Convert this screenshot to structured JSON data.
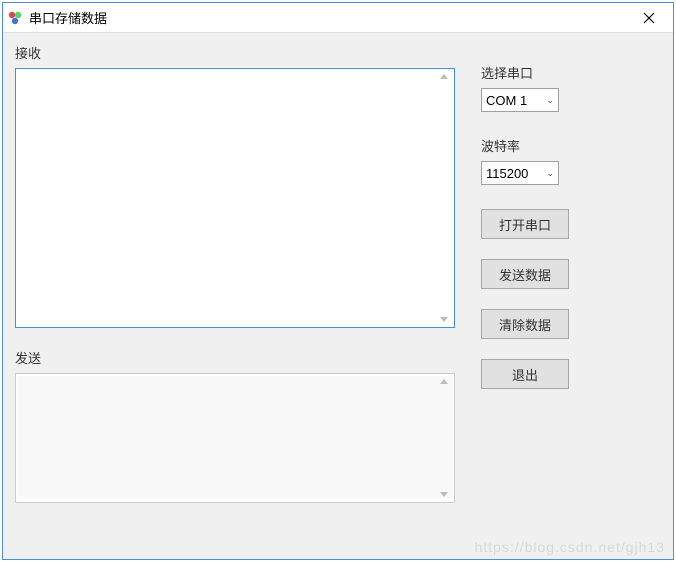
{
  "window": {
    "title": "串口存储数据"
  },
  "recv": {
    "label": "接收",
    "value": ""
  },
  "send": {
    "label": "发送",
    "value": ""
  },
  "port": {
    "label": "选择串口",
    "selected": "COM 1"
  },
  "baud": {
    "label": "波特率",
    "selected": "115200"
  },
  "buttons": {
    "open": "打开串口",
    "sendData": "发送数据",
    "clear": "清除数据",
    "exit": "退出"
  },
  "watermark": "https://blog.csdn.net/gjh13"
}
